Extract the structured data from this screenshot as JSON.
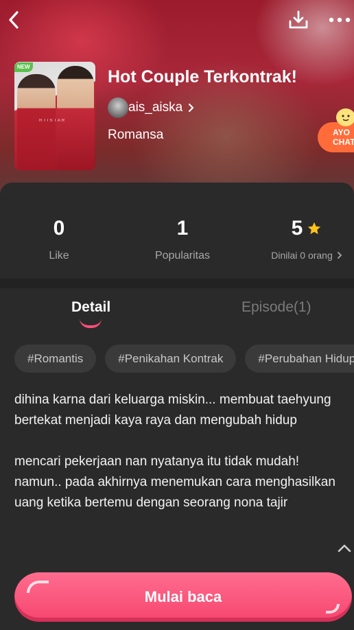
{
  "header": {
    "back_icon": "chevron-left-icon",
    "download_icon": "download-icon",
    "more_icon": "more-horizontal-icon"
  },
  "story": {
    "badge": "NEW",
    "cover_brand": "RTISTAR",
    "title": "Hot Couple Terkontrak!",
    "author": "ais_aiska",
    "genre": "Romansa"
  },
  "chat_promo": {
    "line1": "AYO",
    "line2": "CHAT",
    "accent": "#ff6c3a"
  },
  "stats": {
    "like_value": "0",
    "like_label": "Like",
    "popularity_value": "1",
    "popularity_label": "Popularitas",
    "rating_value": "5",
    "rating_label": "Dinilai 0 orang"
  },
  "tabs": [
    {
      "label": "Detail",
      "active": true
    },
    {
      "label": "Episode(1)",
      "active": false
    }
  ],
  "tags": [
    "#Romantis",
    "#Penikahan Kontrak",
    "#Perubahan Hidup"
  ],
  "description": {
    "paragraph1": "dihina karna dari keluarga miskin... membuat taehyung bertekat menjadi kaya raya dan mengubah hidup",
    "paragraph2": "mencari pekerjaan nan nyatanya itu tidak mudah! namun.. pada akhirnya menemukan cara menghasilkan uang ketika bertemu dengan seorang nona tajir"
  },
  "cta": {
    "label": "Mulai baca",
    "color": "#f6456f"
  },
  "colors": {
    "background": "#2a2a2a",
    "accent_pink": "#ff4f7b",
    "star": "#ffc21a",
    "badge_green": "#5cc04e"
  }
}
